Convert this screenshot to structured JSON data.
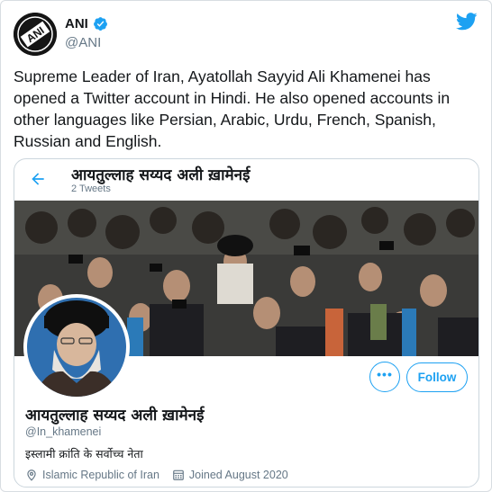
{
  "tweet": {
    "author_name": "ANI",
    "author_handle": "@ANI",
    "avatar_logo_text": "ANI",
    "text": "Supreme Leader of Iran, Ayatollah Sayyid Ali Khamenei has opened a Twitter account in Hindi. He also opened accounts in other languages like Persian, Arabic, Urdu, French, Spanish, Russian and English."
  },
  "card": {
    "header_name": "आयतुल्लाह सय्यद अली ख़ामेनई",
    "tweet_count": "2 Tweets",
    "follow_label": "Follow",
    "more_label": "•••",
    "profile_name": "आयतुल्लाह सय्यद अली ख़ामेनई",
    "profile_handle": "@In_khamenei",
    "bio": "इस्लामी क्रांति के सर्वोच्च नेता",
    "location": "Islamic Republic of Iran",
    "joined": "Joined August 2020"
  },
  "icons": {
    "verified": "verified-badge-icon",
    "twitter": "twitter-bird-icon",
    "back": "back-arrow-icon",
    "location": "location-pin-icon",
    "calendar": "calendar-icon"
  },
  "colors": {
    "accent": "#1da1f2",
    "secondary_text": "#657786",
    "border": "#ccd6dd"
  }
}
